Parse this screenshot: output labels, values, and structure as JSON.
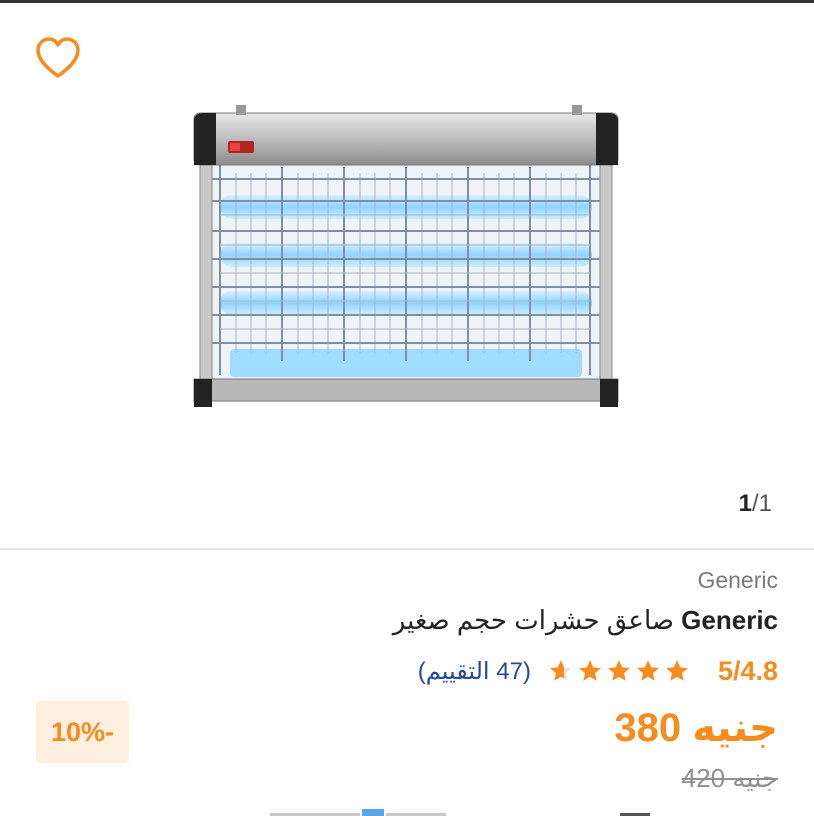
{
  "gallery": {
    "counter_current": "1",
    "counter_total": "/1",
    "image_icon": "bug-zapper-image",
    "wishlist_icon": "heart-outline-icon"
  },
  "product": {
    "brand": "Generic",
    "title_brand": "Generic",
    "title_text": " صاعق حشرات حجم صغير",
    "rating_value": "5/4.8",
    "rating_stars": 4.8,
    "reviews": "(47 التقييم)",
    "price": "جنيه 380",
    "old_price": "جنيه 420",
    "discount": "10%-"
  },
  "colors": {
    "accent": "#f68b1e",
    "link": "#264996",
    "discount_bg": "#feefde"
  }
}
